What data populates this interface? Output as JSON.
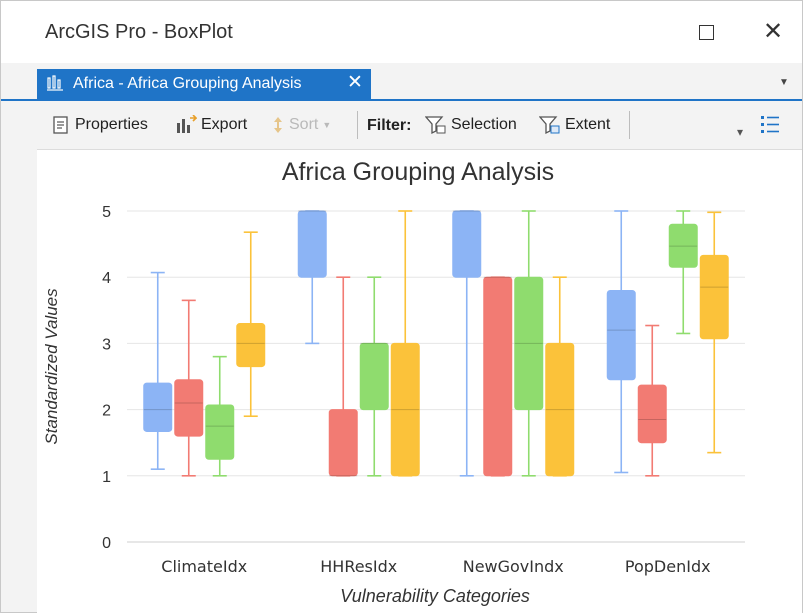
{
  "window": {
    "title": "ArcGIS Pro - BoxPlot",
    "maximize_icon": "maximize-icon",
    "close_label": "✕"
  },
  "tab": {
    "label": "Africa - Africa Grouping Analysis",
    "close_label": "✕",
    "icon": "chart-icon"
  },
  "toolbar": {
    "properties_label": "Properties",
    "export_label": "Export",
    "sort_label": "Sort",
    "filter_label": "Filter:",
    "selection_label": "Selection",
    "extent_label": "Extent"
  },
  "colors": {
    "accent": "#1f74c7",
    "series_blue": "#8cb4f5",
    "series_red": "#f27b73",
    "series_green": "#8fdc6e",
    "series_orange": "#fbc23a"
  },
  "chart_data": {
    "type": "boxplot",
    "title": "Africa Grouping Analysis",
    "xlabel": "Vulnerability Categories",
    "ylabel": "Standardized Values",
    "ylim": [
      0,
      5
    ],
    "yticks": [
      0,
      1,
      2,
      3,
      4,
      5
    ],
    "grid": true,
    "categories": [
      "ClimateIdx",
      "HHResIdx",
      "NewGovIndx",
      "PopDenIdx"
    ],
    "series": [
      {
        "color": "#8cb4f5",
        "boxes": [
          {
            "min": 1.1,
            "q1": 1.67,
            "median": 2.0,
            "q3": 2.4,
            "max": 4.07
          },
          {
            "min": 3.0,
            "q1": 4.0,
            "median": 5.0,
            "q3": 5.0,
            "max": 5.0
          },
          {
            "min": 1.0,
            "q1": 4.0,
            "median": 5.0,
            "q3": 5.0,
            "max": 5.0
          },
          {
            "min": 1.05,
            "q1": 2.45,
            "median": 3.2,
            "q3": 3.8,
            "max": 5.0
          }
        ]
      },
      {
        "color": "#f27b73",
        "boxes": [
          {
            "min": 1.0,
            "q1": 1.6,
            "median": 2.1,
            "q3": 2.45,
            "max": 3.65
          },
          {
            "min": 1.0,
            "q1": 1.0,
            "median": 1.0,
            "q3": 2.0,
            "max": 4.0
          },
          {
            "min": 1.0,
            "q1": 1.0,
            "median": 4.0,
            "q3": 4.0,
            "max": 4.0
          },
          {
            "min": 1.0,
            "q1": 1.5,
            "median": 1.85,
            "q3": 2.37,
            "max": 3.27
          }
        ]
      },
      {
        "color": "#8fdc6e",
        "boxes": [
          {
            "min": 1.0,
            "q1": 1.25,
            "median": 1.75,
            "q3": 2.07,
            "max": 2.8
          },
          {
            "min": 1.0,
            "q1": 2.0,
            "median": 3.0,
            "q3": 3.0,
            "max": 4.0
          },
          {
            "min": 1.0,
            "q1": 2.0,
            "median": 3.0,
            "q3": 4.0,
            "max": 5.0
          },
          {
            "min": 3.15,
            "q1": 4.15,
            "median": 4.47,
            "q3": 4.8,
            "max": 5.0
          }
        ]
      },
      {
        "color": "#fbc23a",
        "boxes": [
          {
            "min": 1.9,
            "q1": 2.65,
            "median": 3.0,
            "q3": 3.3,
            "max": 4.68
          },
          {
            "min": 1.0,
            "q1": 1.0,
            "median": 2.0,
            "q3": 3.0,
            "max": 5.0
          },
          {
            "min": 1.0,
            "q1": 1.0,
            "median": 2.0,
            "q3": 3.0,
            "max": 4.0
          },
          {
            "min": 1.35,
            "q1": 3.07,
            "median": 3.85,
            "q3": 4.33,
            "max": 4.98
          }
        ]
      }
    ]
  }
}
